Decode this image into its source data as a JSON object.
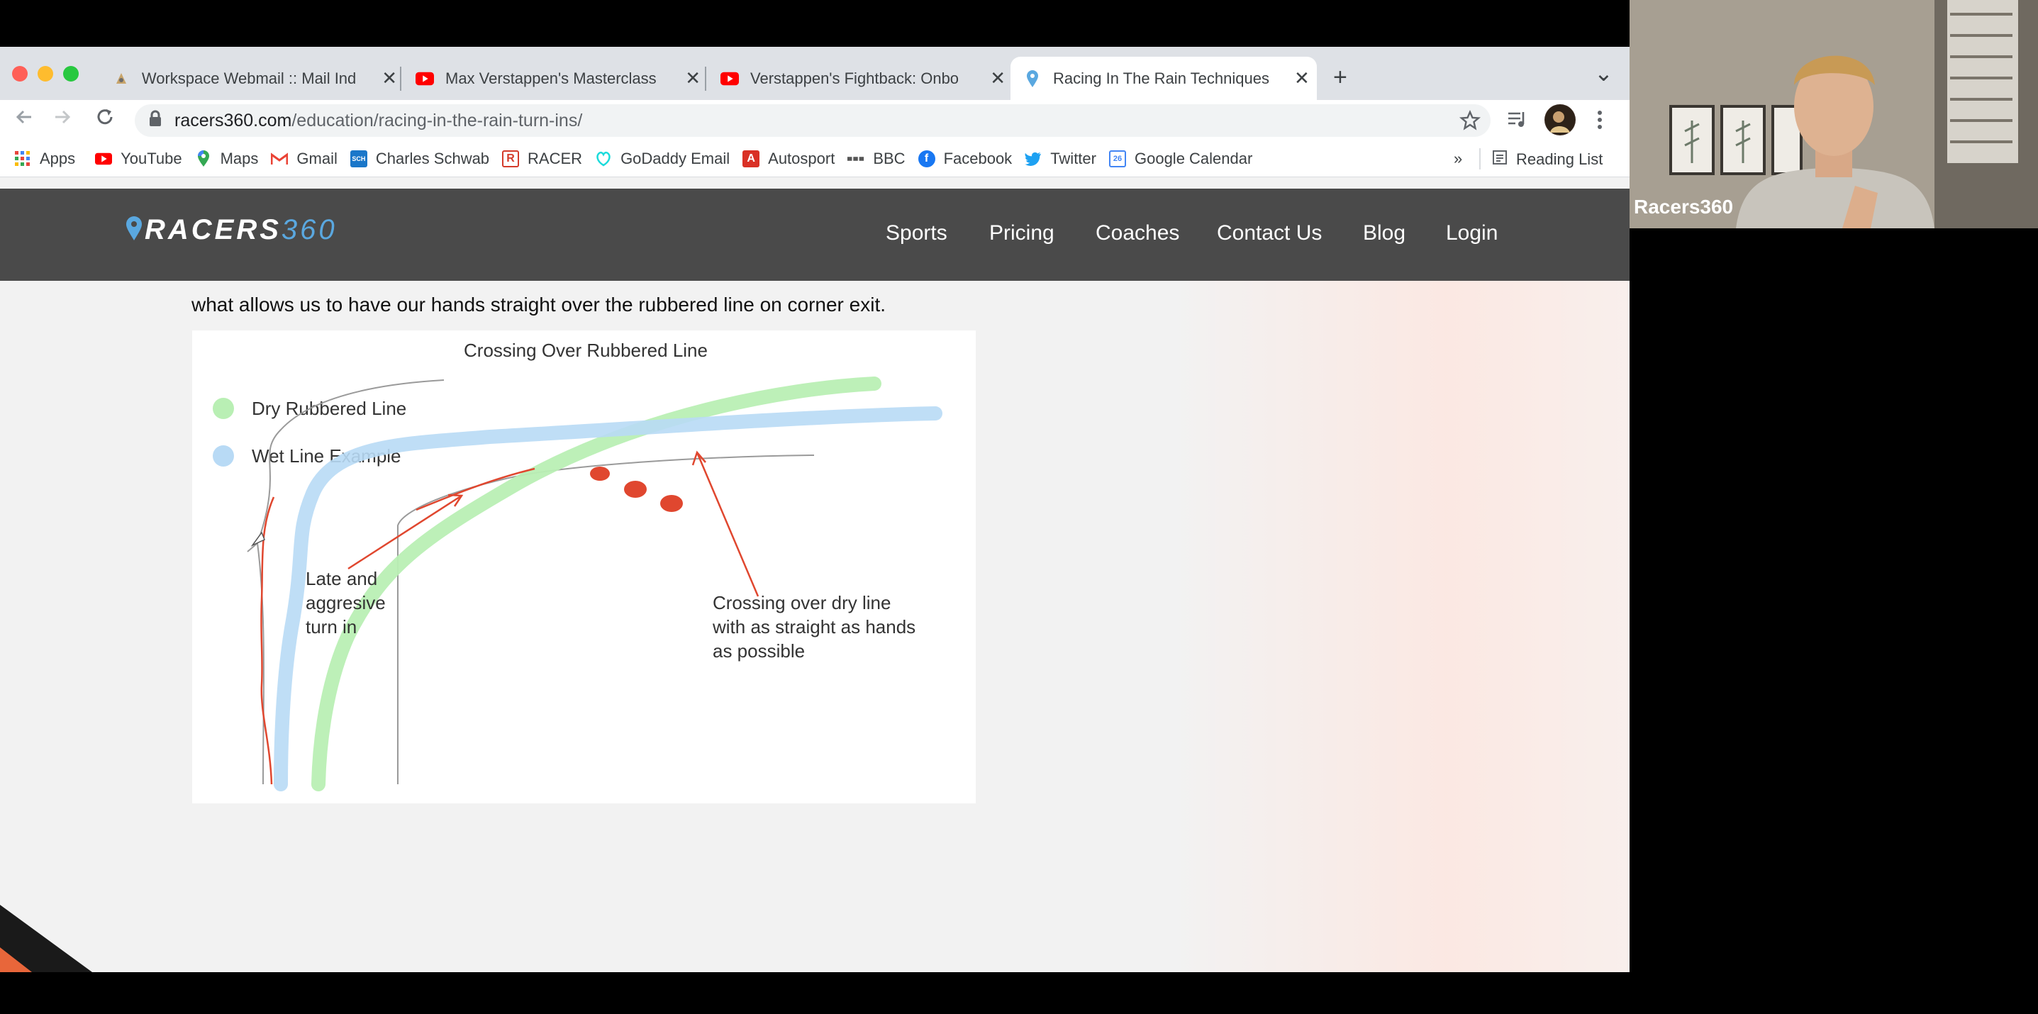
{
  "browser": {
    "tabs": [
      {
        "title": "Workspace Webmail :: Mail Ind",
        "close": "✕"
      },
      {
        "title": "Max Verstappen's Masterclass",
        "close": "✕"
      },
      {
        "title": "Verstappen's Fightback: Onbo",
        "close": "✕"
      },
      {
        "title": "Racing In The Rain Techniques",
        "close": "✕"
      }
    ],
    "new_tab": "+",
    "tab_menu": "⌄",
    "url_domain": "racers360.com",
    "url_path": "/education/racing-in-the-rain-turn-ins/",
    "bookmarks": [
      {
        "label": "Apps",
        "icon": "apps-grid-icon"
      },
      {
        "label": "YouTube",
        "icon": "youtube-icon"
      },
      {
        "label": "Maps",
        "icon": "maps-icon"
      },
      {
        "label": "Gmail",
        "icon": "gmail-icon"
      },
      {
        "label": "Charles Schwab",
        "icon": "schwab-icon"
      },
      {
        "label": "RACER",
        "icon": "racer-icon"
      },
      {
        "label": "GoDaddy Email",
        "icon": "godaddy-icon"
      },
      {
        "label": "Autosport",
        "icon": "autosport-icon"
      },
      {
        "label": "BBC",
        "icon": "bbc-icon"
      },
      {
        "label": "Facebook",
        "icon": "facebook-icon"
      },
      {
        "label": "Twitter",
        "icon": "twitter-icon"
      },
      {
        "label": "Google Calendar",
        "icon": "calendar-icon"
      }
    ],
    "bookmarks_overflow": "»",
    "reading_list": "Reading List"
  },
  "site": {
    "logo_main": "RACERS",
    "logo_num": "360",
    "nav": [
      "Sports",
      "Pricing",
      "Coaches",
      "Contact Us",
      "Blog",
      "Login"
    ],
    "paragraph": "what allows us to have our hands straight over the rubbered line on corner exit."
  },
  "figure": {
    "title": "Crossing Over Rubbered Line",
    "legend": [
      {
        "label": "Dry Rubbered Line",
        "color": "#b9efb4"
      },
      {
        "label": "Wet Line Example",
        "color": "#b8daf5"
      }
    ],
    "annotation_left": [
      "Late and",
      "aggresive",
      "turn in"
    ],
    "annotation_right": [
      "Crossing over dry line",
      "with as straight as hands",
      "as possible"
    ]
  },
  "webcam": {
    "label": "Racers360"
  },
  "colors": {
    "nav_bg": "#4a4a4a",
    "logo_blue": "#5aa8e0",
    "annotation_red": "#e0472f"
  }
}
